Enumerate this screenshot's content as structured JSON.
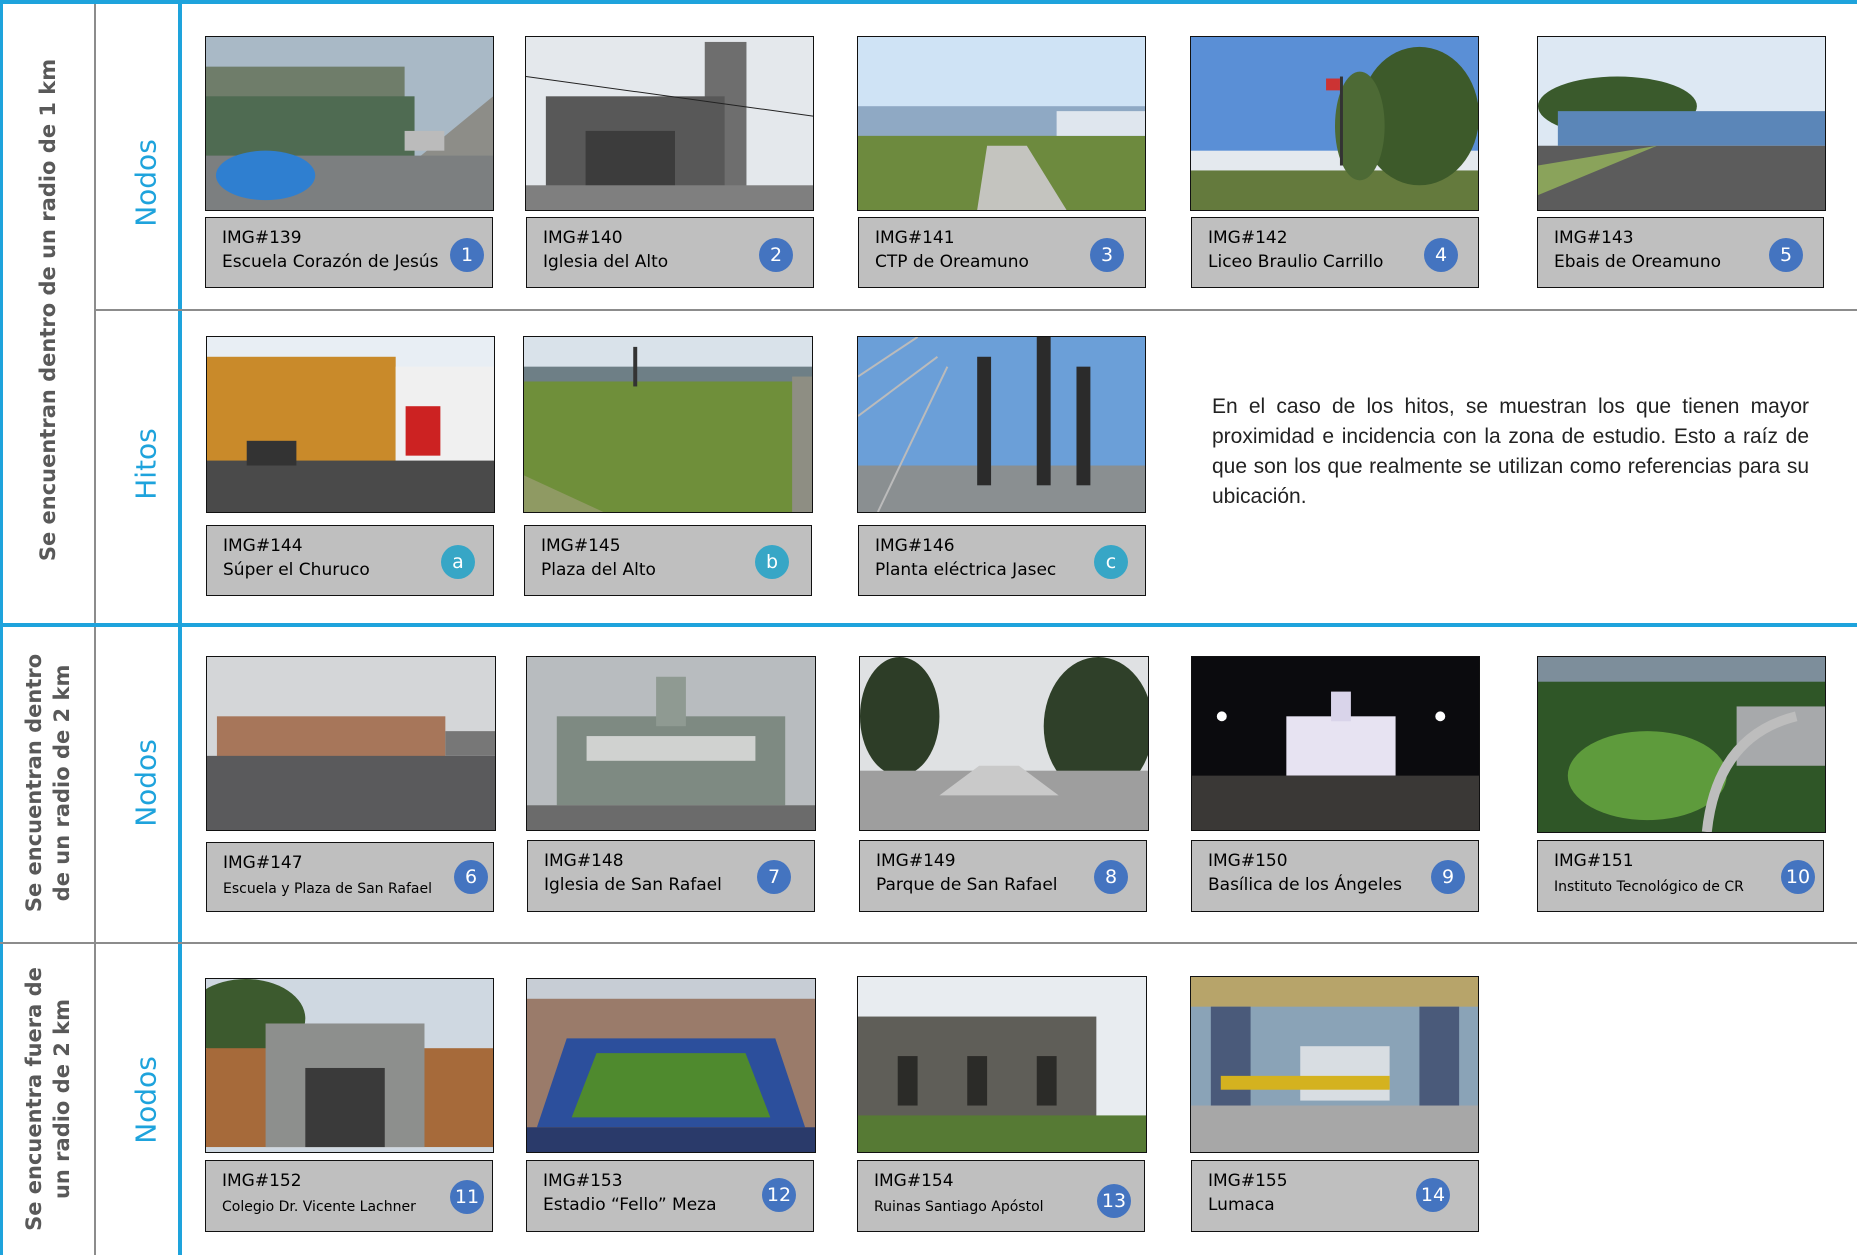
{
  "sections": {
    "s1": "Se encuentran dentro de un radio de 1 km",
    "s2_line1": "Se encuentran dentro",
    "s2_line2": "de un radio de 2 km",
    "s3_line1": "Se encuentra fuera de",
    "s3_line2": "un radio de 2 km"
  },
  "subsections": {
    "nodos_1": "Nodos",
    "hitos_1": "Hitos",
    "nodos_2": "Nodos",
    "nodos_3": "Nodos"
  },
  "note": "En el caso de los hitos, se muestran los que tienen mayor proximidad e incidencia con la zona de estudio. Esto a raíz de que son los que realmente se utilizan como referencias para su ubicación.",
  "items": [
    {
      "id": "IMG#139",
      "name": "Escuela Corazón de Jesús",
      "badge": "1"
    },
    {
      "id": "IMG#140",
      "name": "Iglesia del Alto",
      "badge": "2"
    },
    {
      "id": "IMG#141",
      "name": "CTP de Oreamuno",
      "badge": "3"
    },
    {
      "id": "IMG#142",
      "name": "Liceo Braulio Carrillo",
      "badge": "4"
    },
    {
      "id": "IMG#143",
      "name": "Ebais de Oreamuno",
      "badge": "5"
    },
    {
      "id": "IMG#144",
      "name": "Súper el Churuco",
      "badge": "a"
    },
    {
      "id": "IMG#145",
      "name": "Plaza del Alto",
      "badge": "b"
    },
    {
      "id": "IMG#146",
      "name": "Planta eléctrica Jasec",
      "badge": "c"
    },
    {
      "id": "IMG#147",
      "name": "Escuela y Plaza de San Rafael",
      "badge": "6"
    },
    {
      "id": "IMG#148",
      "name": "Iglesia de San Rafael",
      "badge": "7"
    },
    {
      "id": "IMG#149",
      "name": "Parque de San Rafael",
      "badge": "8"
    },
    {
      "id": "IMG#150",
      "name": "Basílica de los Ángeles",
      "badge": "9"
    },
    {
      "id": "IMG#151",
      "name": "Instituto Tecnológico de CR",
      "badge": "10"
    },
    {
      "id": "IMG#152",
      "name": "Colegio  Dr. Vicente Lachner",
      "badge": "11"
    },
    {
      "id": "IMG#153",
      "name": "Estadio “Fello” Meza",
      "badge": "12"
    },
    {
      "id": "IMG#154",
      "name": "Ruinas Santiago Apóstol",
      "badge": "13"
    },
    {
      "id": "IMG#155",
      "name": "Lumaca",
      "badge": "14"
    }
  ],
  "colors": {
    "accent": "#1ea3dc",
    "badge_nodo": "#4474c0",
    "badge_hito": "#37a6c6",
    "caption_bg": "#bfbfbf"
  }
}
